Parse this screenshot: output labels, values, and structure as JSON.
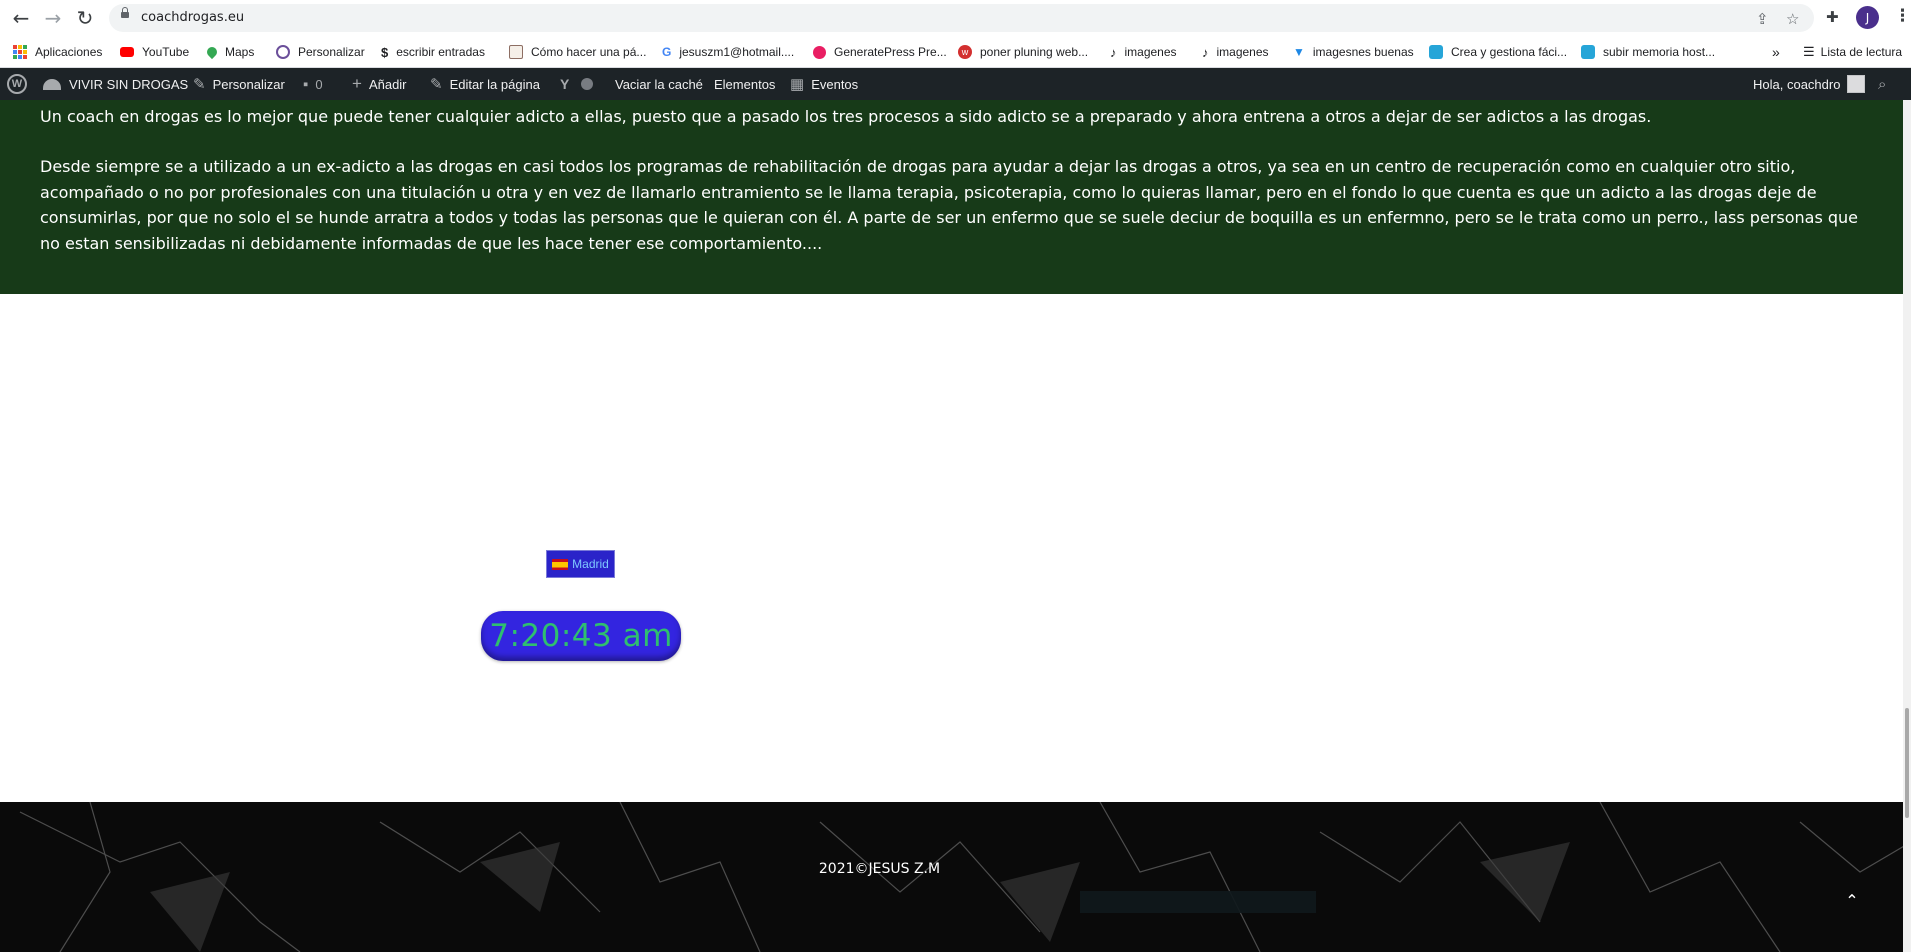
{
  "browser": {
    "url": "coachdrogas.eu",
    "profile_initial": "J"
  },
  "bookmarks": [
    {
      "label": "Aplicaciones",
      "icon": "apps-grid-icon"
    },
    {
      "label": "YouTube",
      "icon": "youtube-icon",
      "color": "#ff0000"
    },
    {
      "label": "Maps",
      "icon": "maps-pin-icon",
      "color": "#34a853"
    },
    {
      "label": "Personalizar",
      "icon": "wordpress-icon",
      "color": "#6b4f9a"
    },
    {
      "label": "escribir entradas",
      "icon": "dollar-icon",
      "color": "#202124"
    },
    {
      "label": "Cómo hacer una pá...",
      "icon": "page-icon",
      "color": "#8d6e63"
    },
    {
      "label": "jesuszm1@hotmail....",
      "icon": "google-icon",
      "color": "#4285f4"
    },
    {
      "label": "GeneratePress Pre...",
      "icon": "generatepress-icon",
      "color": "#e91e63"
    },
    {
      "label": "poner pluning web...",
      "icon": "w-circle-icon",
      "color": "#d32f2f"
    },
    {
      "label": "imagenes",
      "icon": "tiktok-icon",
      "color": "#111111"
    },
    {
      "label": "imagenes",
      "icon": "tiktok-icon",
      "color": "#111111"
    },
    {
      "label": "imagesnes buenas",
      "icon": "vector-v-icon",
      "color": "#1e88e5"
    },
    {
      "label": "Crea y gestiona fáci...",
      "icon": "s-square-icon",
      "color": "#26a5d8"
    },
    {
      "label": "subir memoria host...",
      "icon": "s-square-icon",
      "color": "#26a5d8"
    },
    {
      "label": "Lista de lectura",
      "icon": "reading-list-icon",
      "color": "#202124"
    }
  ],
  "adminbar": {
    "site_name": "VIVIR SIN DROGAS",
    "customize": "Personalizar",
    "comments_count": "0",
    "add_new": "Añadir",
    "edit_page": "Editar la página",
    "clear_cache": "Vaciar la caché",
    "elements": "Elementos",
    "events": "Eventos",
    "greeting": "Hola, coachdro"
  },
  "content": {
    "paragraph1": "Un coach en drogas es lo mejor que puede tener cualquier adicto a ellas, puesto que a pasado los tres procesos a sido adicto se a preparado y ahora entrena a otros a dejar de ser adictos a las drogas.",
    "paragraph2": "Desde siempre se a utilizado a un ex-adicto a las drogas en casi todos los programas de rehabilitación de drogas para ayudar a dejar las drogas a otros, ya sea en un centro de recuperación como en cualquier otro sitio, acompañado o no por profesionales con una titulación u otra y en vez de llamarlo entramiento se le llama terapia, psicoterapia, como lo quieras llamar, pero en el fondo lo que cuenta es que un adicto a las drogas deje de consumirlas, por que no solo el se hunde arratra a todos y todas las personas que le quieran con él. A parte de ser un enfermo que se suele deciur de boquilla es un enfermno, pero se le trata como un perro., lass personas que no estan sensibilizadas ni debidamente informadas de que les hace tener ese comportamiento...."
  },
  "clock_widget": {
    "city": "Madrid",
    "time": "7:20:43 am",
    "badge_color": "#2a23c9",
    "clock_color": "#3325e0",
    "digit_color": "#2fbf6f"
  },
  "footer": {
    "copyright": "2021©JESUS Z.M"
  },
  "colors": {
    "section_bg": "#173a18",
    "adminbar_bg": "#1d2327",
    "footer_bg": "#0a0a0a"
  }
}
